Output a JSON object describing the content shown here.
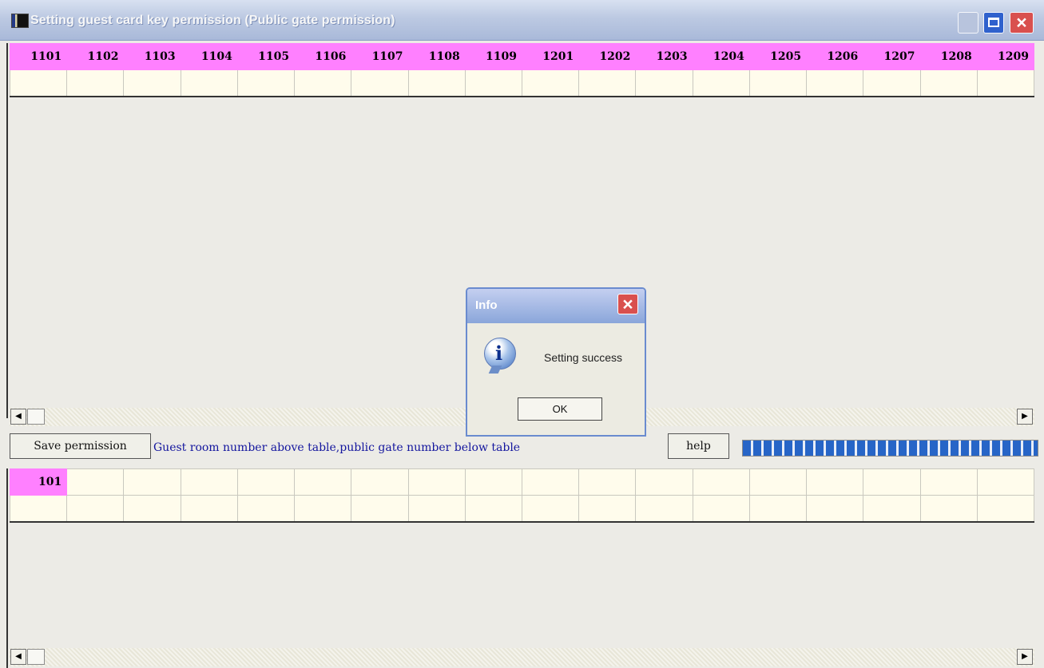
{
  "window": {
    "title": "Setting guest card key permission (Public gate permission)"
  },
  "top_table": {
    "headers": [
      "1101",
      "1102",
      "1103",
      "1104",
      "1105",
      "1106",
      "1107",
      "1108",
      "1109",
      "1201",
      "1202",
      "1203",
      "1204",
      "1205",
      "1206",
      "1207",
      "1208",
      "1209"
    ]
  },
  "controls": {
    "save_label": "Save permission",
    "hint": "Guest room number above table,public gate number below table",
    "help_label": "help",
    "progress_percent": 100
  },
  "bottom_table": {
    "gate_label": "101"
  },
  "dialog": {
    "title": "Info",
    "message": "Setting success",
    "ok_label": "OK"
  },
  "scroll_arrows": {
    "left": "◀",
    "right": "▶"
  }
}
